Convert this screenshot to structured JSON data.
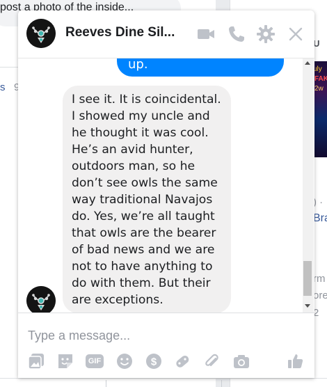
{
  "background_page": {
    "post_text": "post a photo of the inside...",
    "left_fragment_s": "s",
    "left_fragment_9": "9",
    "right_header_fragment": "OU",
    "thumb_text_1": "uly",
    "thumb_text_2": "FAKI",
    "thumb_text_3": "2w",
    "right_fragment_dot": ") ·",
    "right_fragment_bra": "Bra",
    "right_fragment_rm": "rm",
    "right_fragment_ore": "ore",
    "right_fragment_2": "2"
  },
  "chat": {
    "contact_name": "Reeves Dine Sil...",
    "header_icons": [
      "video-call-icon",
      "phone-icon",
      "gear-icon",
      "close-icon"
    ],
    "messages": [
      {
        "direction": "outgoing",
        "text": "up."
      },
      {
        "direction": "incoming",
        "text": "I see it. It is coincidental.\nI showed my uncle and\nhe thought it was cool.\nHe’s an avid hunter,\noutdoors man, so he\ndon’t see owls the same\nway traditional Navajos\ndo. Yes, we’re all taught\nthat owls are the bearer\nof bad news and we are\nnot to have anything to\ndo with them. But their\nare exceptions."
      }
    ],
    "composer": {
      "placeholder": "Type a message...",
      "value": "",
      "gif_label": "GIF",
      "tools": [
        "photo-icon",
        "sticker-icon",
        "gif-icon",
        "emoji-icon",
        "payment-icon",
        "game-icon",
        "attachment-icon",
        "camera-icon",
        "thumbs-up-icon"
      ]
    }
  },
  "colors": {
    "accent": "#0084ff",
    "icon_gray": "#bec2c9",
    "bubble_in": "#f1f0f0",
    "link": "#365899"
  }
}
